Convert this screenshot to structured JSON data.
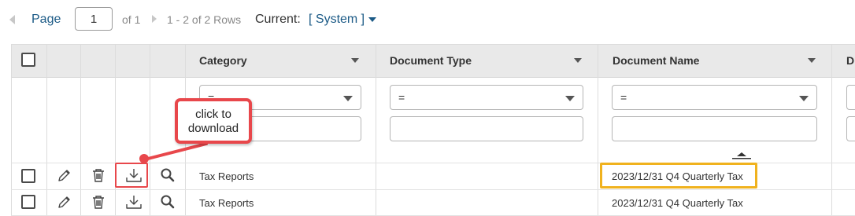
{
  "pager": {
    "page_label": "Page",
    "page_value": "1",
    "of_label": "of 1",
    "rows_label": "1 - 2 of 2 Rows",
    "current_label": "Current:",
    "current_value": "[ System ]"
  },
  "columns": [
    {
      "label": "Category"
    },
    {
      "label": "Document Type"
    },
    {
      "label": "Document Name"
    },
    {
      "label": "Di"
    }
  ],
  "filters": {
    "operator": "="
  },
  "rows": [
    {
      "category": "Tax Reports",
      "document_type": "",
      "document_name": "2023/12/31 Q4 Quarterly Tax"
    },
    {
      "category": "Tax Reports",
      "document_type": "",
      "document_name": "2023/12/31 Q4 Quarterly Tax"
    }
  ],
  "row_icons": [
    "pencil-icon",
    "trash-icon",
    "download-icon",
    "magnifier-icon"
  ],
  "annotation": {
    "line1": "click to",
    "line2": "download"
  },
  "colors": {
    "link": "#1b5a86",
    "annotation_red": "#e8474b",
    "highlight_gold": "#f0b21e",
    "header_bg": "#e9e9e9"
  }
}
